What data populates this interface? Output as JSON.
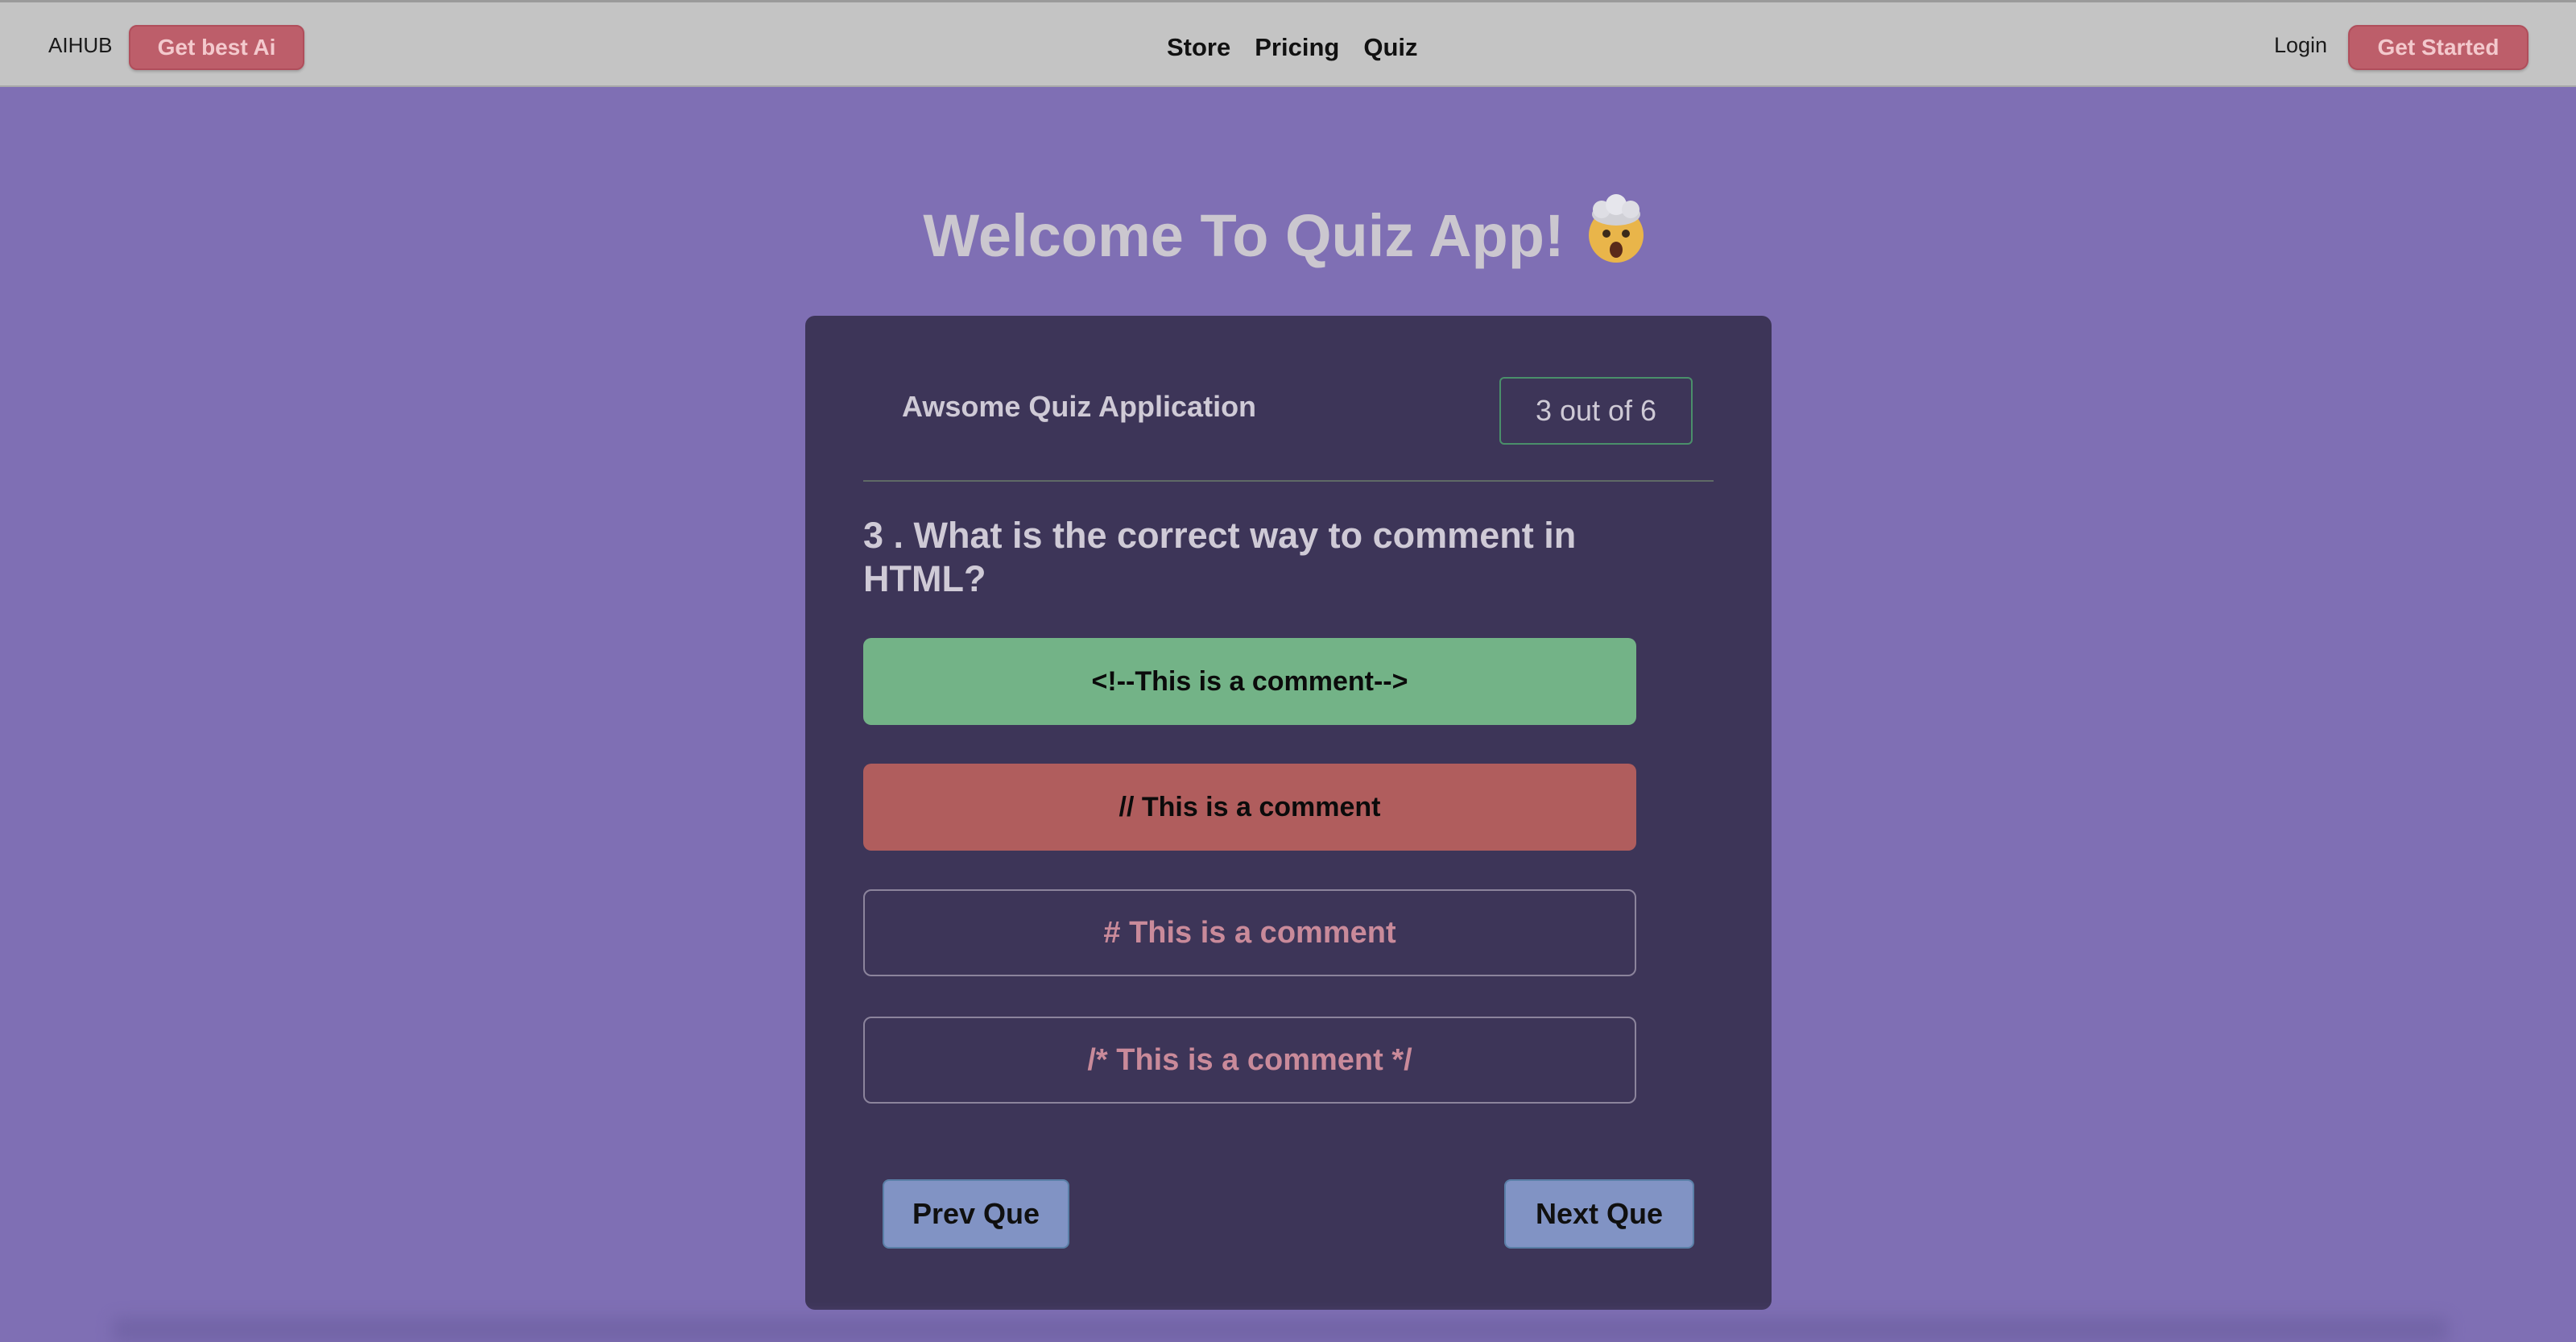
{
  "navbar": {
    "brand": "AIHUB",
    "cta_left": "Get best Ai",
    "links": [
      "Store",
      "Pricing",
      "Quiz"
    ],
    "login": "Login",
    "cta_right": "Get Started"
  },
  "page": {
    "welcome": "Welcome To Quiz App!",
    "emoji_icon": "exploding-head-icon"
  },
  "quiz": {
    "title": "Awsome Quiz Application",
    "counter": "3 out of 6",
    "question": "3 . What is the correct way to comment in HTML?",
    "options": [
      {
        "text": "<!--This is a comment-->",
        "state": "correct"
      },
      {
        "text": "// This is a comment",
        "state": "wrong"
      },
      {
        "text": "# This is a comment",
        "state": "default"
      },
      {
        "text": "/* This is a comment */",
        "state": "default"
      }
    ],
    "prev_label": "Prev Que",
    "next_label": "Next Que"
  },
  "colors": {
    "background": "#7f6fb4",
    "card": "#3d3558",
    "correct": "#73b387",
    "wrong": "#b05d5d",
    "accent_button": "#bd5e6a",
    "nav_button": "#8193c4"
  }
}
